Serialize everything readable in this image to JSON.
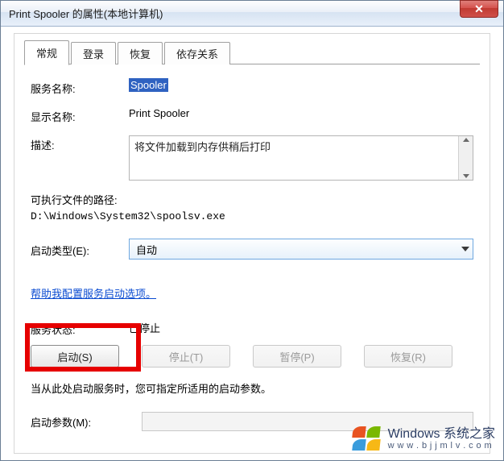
{
  "window": {
    "title": "Print Spooler 的属性(本地计算机)"
  },
  "tabs": [
    {
      "label": "常规",
      "active": true
    },
    {
      "label": "登录",
      "active": false
    },
    {
      "label": "恢复",
      "active": false
    },
    {
      "label": "依存关系",
      "active": false
    }
  ],
  "general": {
    "service_name_label": "服务名称:",
    "service_name_value": "Spooler",
    "display_name_label": "显示名称:",
    "display_name_value": "Print Spooler",
    "description_label": "描述:",
    "description_value": "将文件加载到内存供稍后打印",
    "exe_path_label": "可执行文件的路径:",
    "exe_path_value": "D:\\Windows\\System32\\spoolsv.exe",
    "startup_type_label": "启动类型(E):",
    "startup_type_value": "自动",
    "help_link": "帮助我配置服务启动选项。",
    "status_label": "服务状态:",
    "status_value": "已停止",
    "buttons": {
      "start": "启动(S)",
      "stop": "停止(T)",
      "pause": "暂停(P)",
      "resume": "恢复(R)"
    },
    "hint": "当从此处启动服务时，您可指定所适用的启动参数。",
    "param_label": "启动参数(M):"
  },
  "watermark": {
    "line1": "Windows 系统之家",
    "line2": "w w w . b j j m l v . c o m"
  }
}
